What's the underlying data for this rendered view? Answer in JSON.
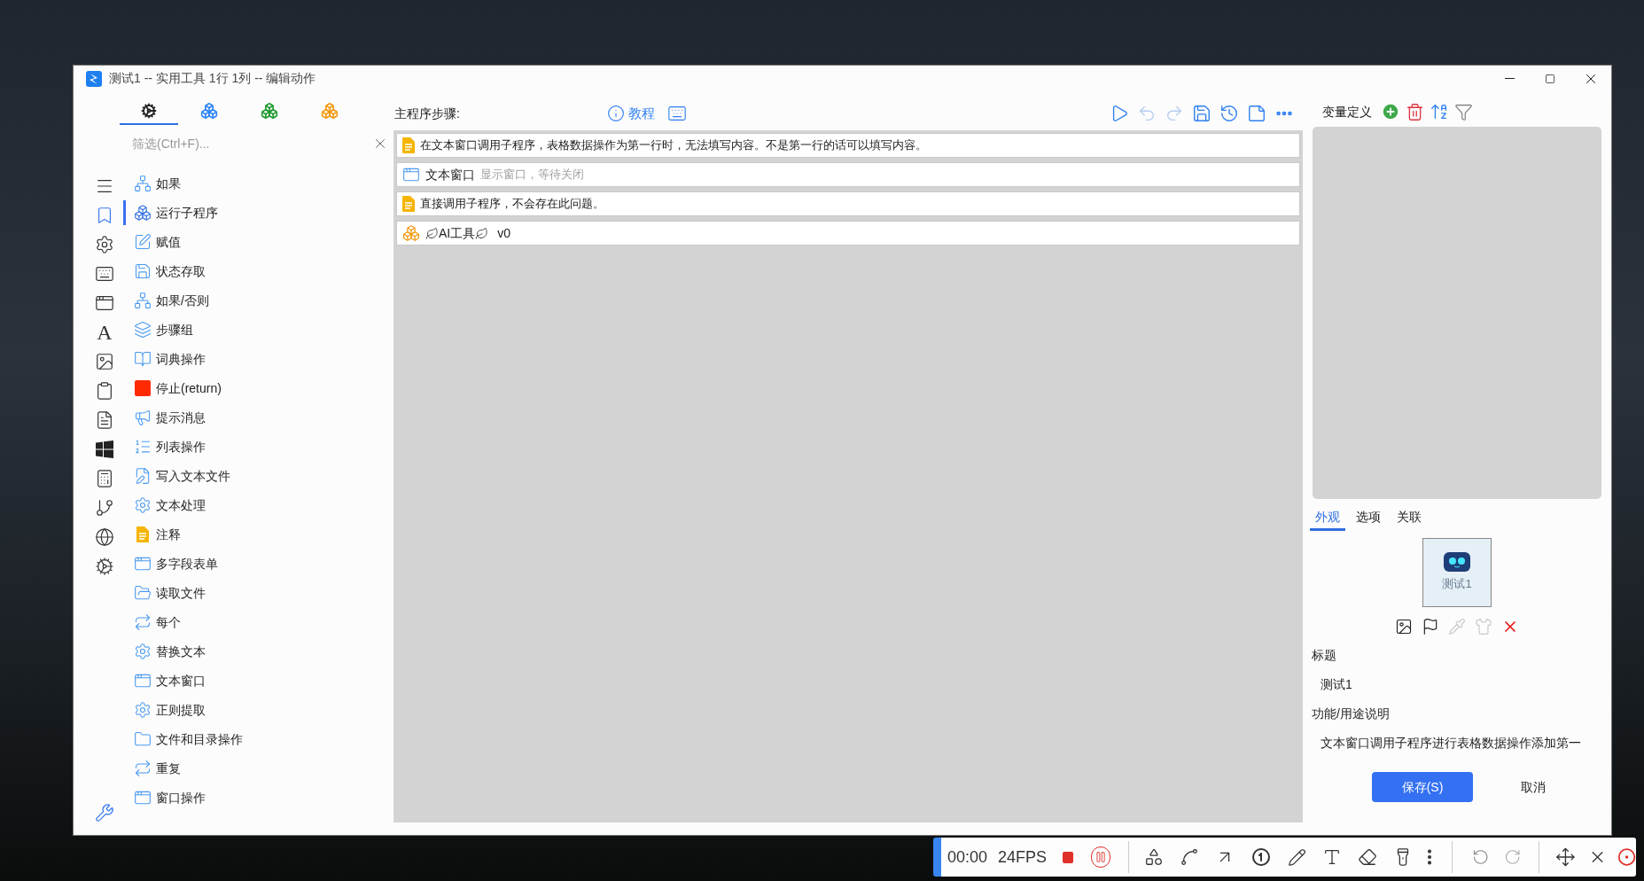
{
  "window": {
    "title": "测试1 -- 实用工具 1行 1列 -- 编辑动作"
  },
  "palette_tabs": [
    {
      "kind": "gears",
      "selected": true
    },
    {
      "kind": "cubes",
      "color": "#2f86f6",
      "selected": false
    },
    {
      "kind": "cubes",
      "color": "#1f9a2e",
      "selected": false
    },
    {
      "kind": "cubes",
      "color": "#f39a12",
      "selected": false
    }
  ],
  "filter": {
    "placeholder": "筛选(Ctrl+F)..."
  },
  "category_icons": [
    {
      "kind": "menu",
      "selected": false
    },
    {
      "kind": "bookmark",
      "selected": true
    },
    {
      "kind": "gear",
      "selected": false
    },
    {
      "kind": "keyboard",
      "selected": false
    },
    {
      "kind": "window",
      "selected": false
    },
    {
      "kind": "glyph",
      "glyph": "A",
      "selected": false
    },
    {
      "kind": "image",
      "selected": false
    },
    {
      "kind": "clipboard",
      "selected": false
    },
    {
      "kind": "document",
      "selected": false
    },
    {
      "kind": "windows",
      "selected": false
    },
    {
      "kind": "calculator",
      "selected": false
    },
    {
      "kind": "branch",
      "selected": false
    },
    {
      "kind": "globe",
      "selected": false
    },
    {
      "kind": "gears",
      "selected": false
    }
  ],
  "actions": [
    {
      "label": "如果",
      "kind": "flow",
      "selected": false
    },
    {
      "label": "运行子程序",
      "kind": "cubes",
      "selected": true
    },
    {
      "label": "赋值",
      "kind": "edit",
      "selected": false
    },
    {
      "label": "状态存取",
      "kind": "save",
      "selected": false
    },
    {
      "label": "如果/否则",
      "kind": "flow",
      "selected": false
    },
    {
      "label": "步骤组",
      "kind": "layers",
      "selected": false
    },
    {
      "label": "词典操作",
      "kind": "book",
      "selected": false
    },
    {
      "label": "停止(return)",
      "kind": "stop",
      "selected": false
    },
    {
      "label": "提示消息",
      "kind": "megaphone",
      "selected": false
    },
    {
      "label": "列表操作",
      "kind": "list",
      "selected": false
    },
    {
      "label": "写入文本文件",
      "kind": "file-edit",
      "selected": false
    },
    {
      "label": "文本处理",
      "kind": "gear",
      "selected": false
    },
    {
      "label": "注释",
      "kind": "note",
      "selected": false
    },
    {
      "label": "多字段表单",
      "kind": "window",
      "selected": false
    },
    {
      "label": "读取文件",
      "kind": "folder-open",
      "selected": false
    },
    {
      "label": "每个",
      "kind": "repeat",
      "selected": false
    },
    {
      "label": "替换文本",
      "kind": "gear",
      "selected": false
    },
    {
      "label": "文本窗口",
      "kind": "window",
      "selected": false
    },
    {
      "label": "正则提取",
      "kind": "gear",
      "selected": false
    },
    {
      "label": "文件和目录操作",
      "kind": "folder",
      "selected": false
    },
    {
      "label": "重复",
      "kind": "repeat",
      "selected": false
    },
    {
      "label": "窗口操作",
      "kind": "window",
      "selected": false
    }
  ],
  "steps": {
    "title": "主程序步骤:",
    "tutorial": "教程",
    "toolbar": [
      {
        "kind": "play",
        "disabled": false
      },
      {
        "kind": "undo",
        "disabled": true
      },
      {
        "kind": "redo",
        "disabled": true
      },
      {
        "kind": "save",
        "disabled": false
      },
      {
        "kind": "history",
        "disabled": false
      },
      {
        "kind": "note",
        "disabled": false
      },
      {
        "kind": "more",
        "disabled": false
      }
    ],
    "rows": [
      {
        "kind": "note",
        "text": "在文本窗口调用子程序，表格数据操作为第一行时，无法填写内容。不是第一行的话可以填写内容。"
      },
      {
        "kind": "window",
        "text": "文本窗口",
        "detail": "显示窗口，等待关闭"
      },
      {
        "kind": "note",
        "text": "直接调用子程序，不会存在此问题。"
      },
      {
        "kind": "subprogram",
        "text": "AI工具",
        "version": "v0"
      }
    ]
  },
  "variables": {
    "title": "变量定义"
  },
  "tabs": [
    {
      "label": "外观",
      "selected": true
    },
    {
      "label": "选项",
      "selected": false
    },
    {
      "label": "关联",
      "selected": false
    }
  ],
  "thumbnail": {
    "caption": "测试1"
  },
  "appearance_tools": [
    {
      "kind": "image",
      "disabled": false
    },
    {
      "kind": "flag",
      "disabled": false
    },
    {
      "kind": "eyedropper",
      "disabled": true
    },
    {
      "kind": "shirt",
      "disabled": true
    },
    {
      "kind": "delete",
      "disabled": false
    }
  ],
  "fields": [
    {
      "label": "标题",
      "value": "测试1"
    },
    {
      "label": "功能/用途说明",
      "value": "文本窗口调用子程序进行表格数据操作添加第一"
    }
  ],
  "buttons": {
    "save": "保存(S)",
    "cancel": "取消"
  },
  "recorder": {
    "time": "00:00",
    "fps": "24FPS"
  }
}
